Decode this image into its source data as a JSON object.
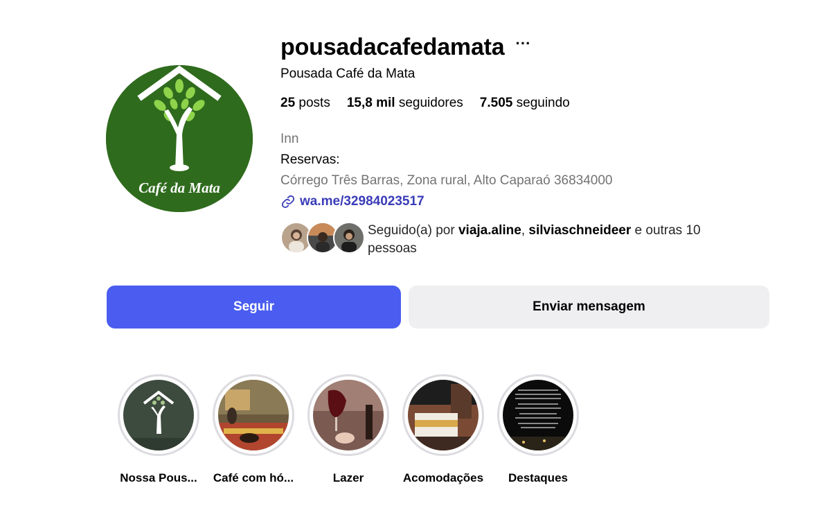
{
  "profile": {
    "username": "pousadacafedamata",
    "more_icon": "···",
    "full_name": "Pousada Café da Mata",
    "avatar_text": "Café da Mata",
    "avatar_colors": {
      "background": "#2f6b1d",
      "accent": "#8ed34a"
    }
  },
  "stats": {
    "posts_count": "25",
    "posts_label": " posts",
    "followers_count": "15,8 mil",
    "followers_label": " seguidores",
    "following_count": "7.505",
    "following_label": " seguindo"
  },
  "bio": {
    "category": "Inn",
    "line1": "Reservas:",
    "address": "Córrego Três Barras, Zona rural, Alto Caparaó 36834000",
    "link": "wa.me/32984023517"
  },
  "followed_by": {
    "prefix": "Seguido(a) por ",
    "user1": "viaja.aline",
    "sep": ", ",
    "user2": "silviaschneideer",
    "suffix": " e outras 10 pessoas"
  },
  "actions": {
    "follow_label": "Seguir",
    "message_label": "Enviar mensagem",
    "follow_color": "#4a5df0"
  },
  "highlights": [
    {
      "label": "Nossa Pous..."
    },
    {
      "label": "Café com hó..."
    },
    {
      "label": "Lazer"
    },
    {
      "label": "Acomodações"
    },
    {
      "label": "Destaques"
    }
  ]
}
